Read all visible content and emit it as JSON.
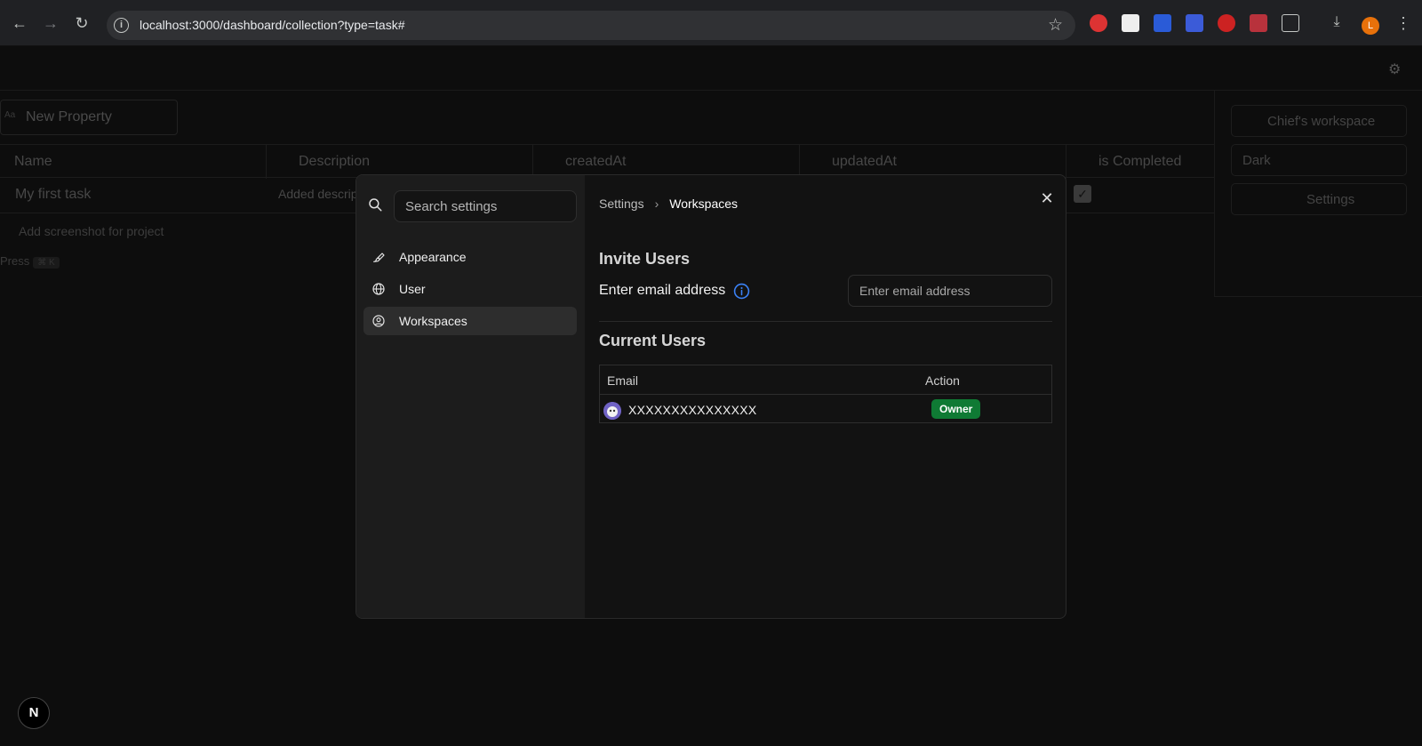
{
  "browser": {
    "url": "localhost:3000/dashboard/collection?type=task#",
    "profile_initial": "L"
  },
  "background_app": {
    "new_property_label": "New Property",
    "columns": [
      "Name",
      "Description",
      "createdAt",
      "updatedAt",
      "is Completed"
    ],
    "row": {
      "name": "My first task",
      "description": "Added descrip"
    },
    "add_screenshot": "Add screenshot for project",
    "press_hint": "Press",
    "press_key": "⌘ K",
    "workspace_selector": "Chief's workspace",
    "theme_selector": "Dark",
    "settings_button": "Settings"
  },
  "settings_modal": {
    "search_placeholder": "Search settings",
    "nav": {
      "appearance": "Appearance",
      "user": "User",
      "workspaces": "Workspaces"
    },
    "breadcrumb": {
      "root": "Settings",
      "separator": "›",
      "current": "Workspaces"
    },
    "invite": {
      "heading": "Invite Users",
      "label": "Enter email address",
      "input_placeholder": "Enter email address"
    },
    "current_users": {
      "heading": "Current Users",
      "columns": {
        "email": "Email",
        "action": "Action"
      },
      "rows": [
        {
          "email": "XXXXXXXXXXXXXXX",
          "role": "Owner"
        }
      ]
    },
    "colors": {
      "owner_badge": "#0f7a34",
      "info_icon": "#3b82f6"
    }
  },
  "nextjs_badge": "N"
}
